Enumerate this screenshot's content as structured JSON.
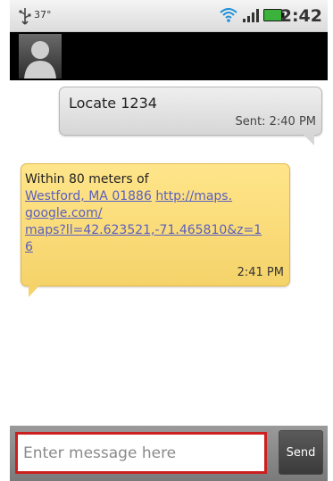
{
  "status_bar": {
    "temperature": "37°",
    "clock": "2:42",
    "icons": [
      "usb-icon",
      "wifi-icon",
      "signal-icon",
      "battery-icon"
    ]
  },
  "header": {
    "avatar": "contact-avatar"
  },
  "messages": [
    {
      "direction": "sent",
      "text": "Locate 1234",
      "timestamp": "Sent: 2:40 PM"
    },
    {
      "direction": "received",
      "text_intro": "Within 80 meters of",
      "address_link": "Westford, MA 01886",
      "maps_link_part1": "http://maps.",
      "maps_link_part2": "google.com/",
      "maps_link_part3": "maps?ll=42.623521,-71.465810&z=1",
      "maps_link_part4": "6",
      "timestamp": "2:41 PM"
    }
  ],
  "compose": {
    "placeholder": "Enter message here",
    "send_label": "Send"
  },
  "colors": {
    "sent_bubble": "#dcdcdc",
    "received_bubble": "#f8d978",
    "link": "#5a5fc0",
    "input_highlight": "#cc1f1f"
  }
}
